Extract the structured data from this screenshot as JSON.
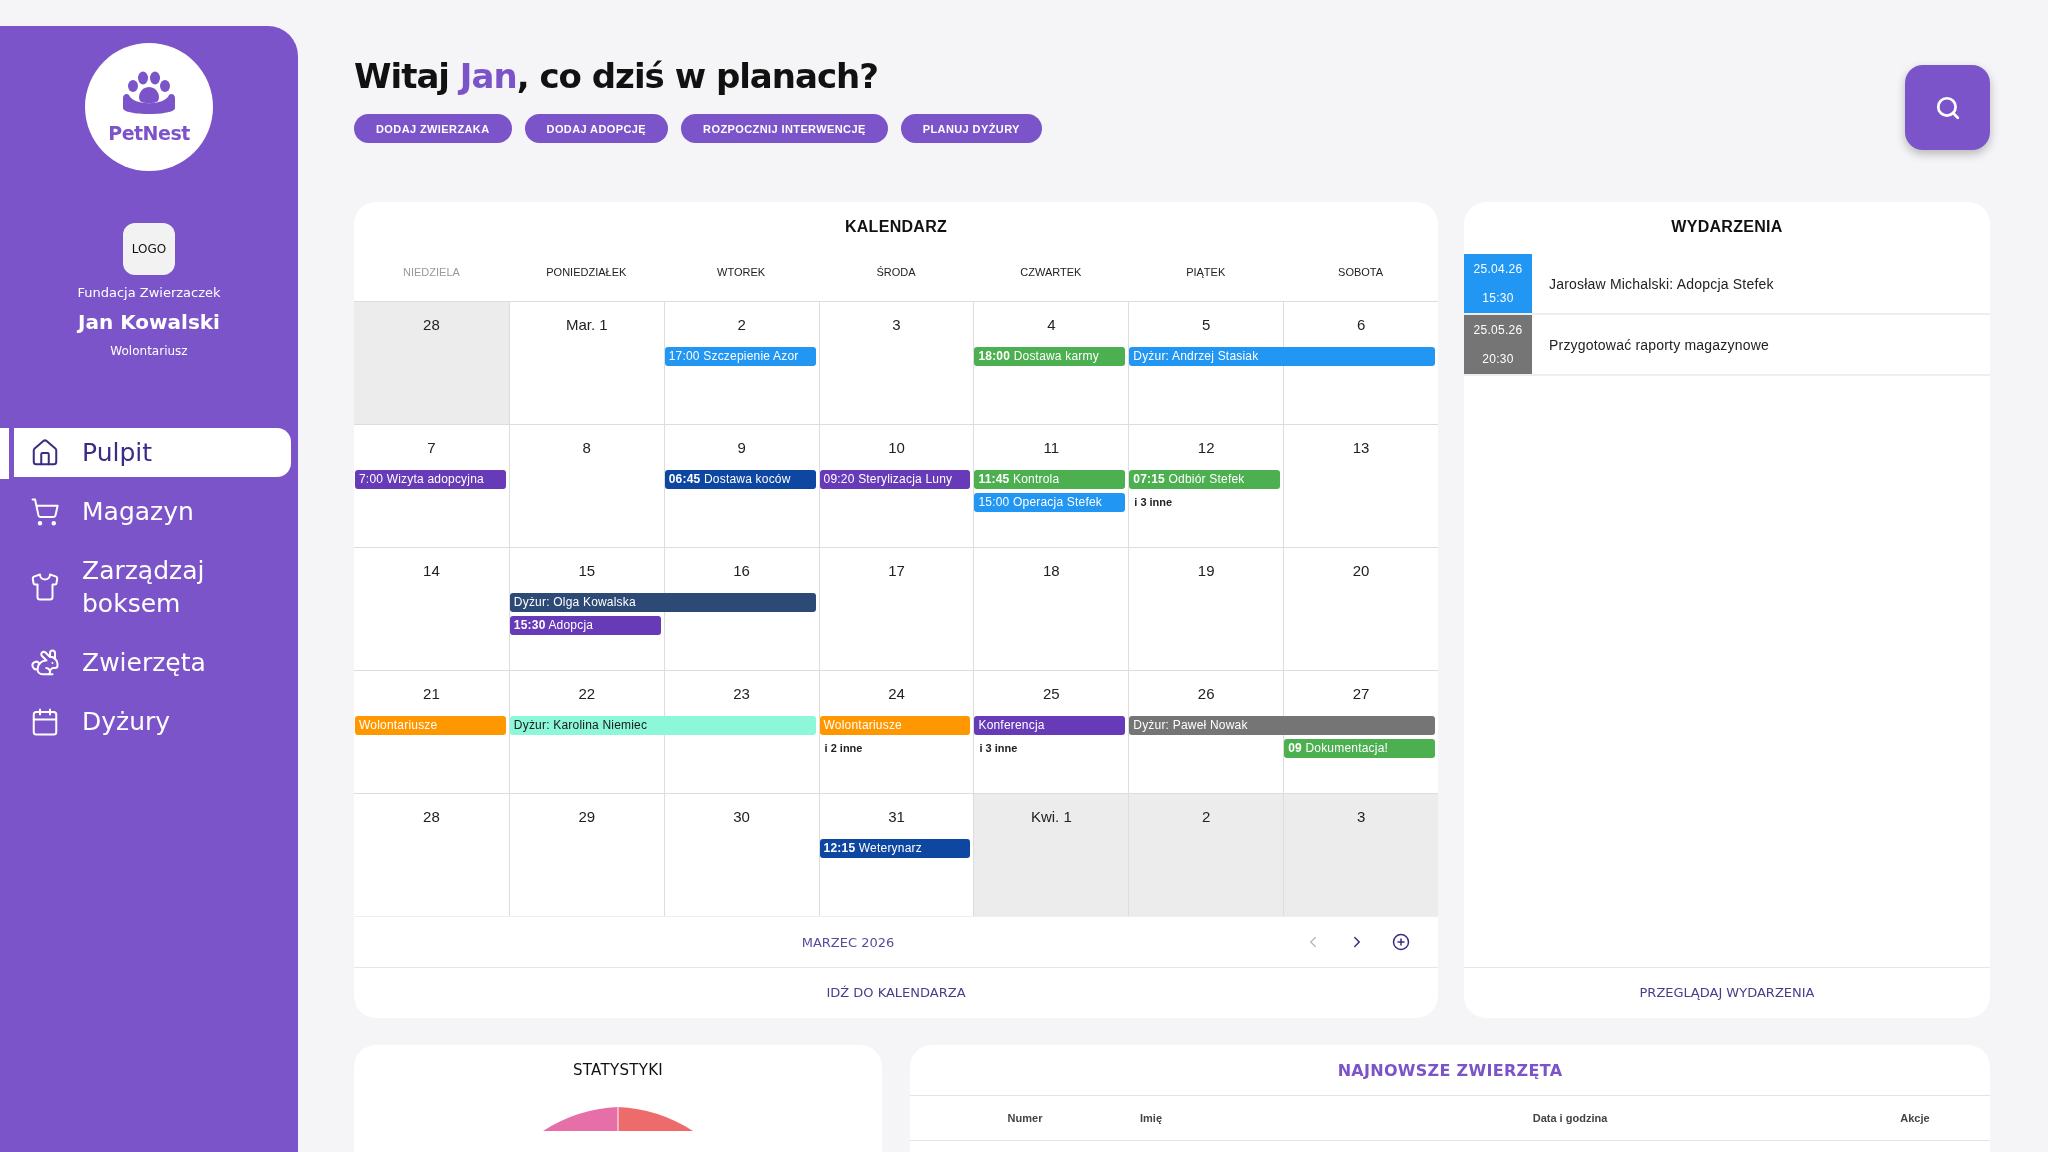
{
  "sidebar": {
    "brand": "PetNest",
    "org_logo": "LOGO",
    "organization": "Fundacja Zwierzaczek",
    "user_name": "Jan Kowalski",
    "user_role": "Wolontariusz",
    "items": [
      {
        "label": "Pulpit",
        "selected": true
      },
      {
        "label": "Magazyn",
        "selected": false
      },
      {
        "label": "Zarządzaj boksem",
        "selected": false
      },
      {
        "label": "Zwierzęta",
        "selected": false
      },
      {
        "label": "Dyżury",
        "selected": false
      }
    ]
  },
  "header": {
    "greeting": "Witaj",
    "name": "Jan",
    "question": ", co dziś w planach?",
    "actions": [
      "DODAJ ZWIERZAKA",
      "DODAJ ADOPCJĘ",
      "ROZPOCZNIJ INTERWENCJĘ",
      "PLANUJ DYŻURY"
    ]
  },
  "calendar": {
    "title": "KALENDARZ",
    "weekdays": [
      {
        "label": "NIEDZIELA",
        "dimmed": true
      },
      {
        "label": "PONIEDZIAŁEK",
        "dimmed": false
      },
      {
        "label": "WTOREK",
        "dimmed": false
      },
      {
        "label": "ŚRODA",
        "dimmed": false
      },
      {
        "label": "CZWARTEK",
        "dimmed": false
      },
      {
        "label": "PIĄTEK",
        "dimmed": false
      },
      {
        "label": "SOBOTA",
        "dimmed": false
      }
    ],
    "weeks": [
      {
        "days": [
          {
            "label": "28",
            "muted": true
          },
          {
            "label": "Mar. 1",
            "muted": false
          },
          {
            "label": "2",
            "muted": false,
            "events": [
              {
                "kind": "event",
                "text": "17:00 Szczepienie Azor",
                "color": "#2196f3"
              }
            ]
          },
          {
            "label": "3",
            "muted": false
          },
          {
            "label": "4",
            "muted": false,
            "events": [
              {
                "kind": "event",
                "text": "**18:00** Dostawa karmy",
                "color": "#4caf50"
              }
            ]
          },
          {
            "label": "5",
            "muted": false,
            "events": [
              {
                "kind": "event",
                "text": "Dyżur: Andrzej Stasiak",
                "color": "#2196f3",
                "continues_next_day": true
              }
            ]
          },
          {
            "label": "6",
            "muted": false
          }
        ]
      },
      {
        "days": [
          {
            "label": "7",
            "muted": false,
            "events": [
              {
                "kind": "event",
                "text": "7:00 Wizyta adopcyjna",
                "color": "#673ab7"
              }
            ]
          },
          {
            "label": "8",
            "muted": false
          },
          {
            "label": "9",
            "muted": false,
            "events": [
              {
                "kind": "event",
                "text": "**06:45** Dostawa koców",
                "color": "#0d47a1"
              }
            ]
          },
          {
            "label": "10",
            "muted": false,
            "events": [
              {
                "kind": "event",
                "text": "09:20 Sterylizacja Luny",
                "color": "#673ab7"
              }
            ]
          },
          {
            "label": "11",
            "muted": false,
            "events": [
              {
                "kind": "event",
                "text": "**11:45** Kontrola",
                "color": "#4caf50"
              },
              {
                "kind": "event",
                "text": "15:00 Operacja Stefek",
                "color": "#2196f3"
              }
            ]
          },
          {
            "label": "12",
            "muted": false,
            "events": [
              {
                "kind": "event",
                "text": "**07:15** Odbiór Stefek",
                "color": "#4caf50"
              },
              {
                "kind": "more",
                "text": "i 3 inne"
              }
            ]
          },
          {
            "label": "13",
            "muted": false
          }
        ]
      },
      {
        "days": [
          {
            "label": "14",
            "muted": false
          },
          {
            "label": "15",
            "muted": false,
            "events": [
              {
                "kind": "event",
                "text": "Dyżur: Olga Kowalska",
                "color": "#2c4a75",
                "continues_next_day": true
              },
              {
                "kind": "event",
                "text": "**15:30** Adopcja",
                "color": "#673ab7"
              }
            ]
          },
          {
            "label": "16",
            "muted": false
          },
          {
            "label": "17",
            "muted": false
          },
          {
            "label": "18",
            "muted": false
          },
          {
            "label": "19",
            "muted": false
          },
          {
            "label": "20",
            "muted": false
          }
        ]
      },
      {
        "days": [
          {
            "label": "21",
            "muted": false,
            "events": [
              {
                "kind": "event",
                "text": "Wolontariusze",
                "color": "#ff9800"
              }
            ]
          },
          {
            "label": "22",
            "muted": false,
            "events": [
              {
                "kind": "event",
                "text": "Dyżur: Karolina Niemiec",
                "color": "#8df7d9",
                "continues_next_day": true
              }
            ]
          },
          {
            "label": "23",
            "muted": false
          },
          {
            "label": "24",
            "muted": false,
            "events": [
              {
                "kind": "event",
                "text": "Wolontariusze",
                "color": "#ff9800"
              },
              {
                "kind": "more",
                "text": "i 2 inne"
              }
            ]
          },
          {
            "label": "25",
            "muted": false,
            "events": [
              {
                "kind": "event",
                "text": "Konferencja",
                "color": "#673ab7"
              },
              {
                "kind": "more",
                "text": "i 3 inne"
              }
            ]
          },
          {
            "label": "26",
            "muted": false,
            "events": [
              {
                "kind": "event",
                "text": "Dyżur: Paweł Nowak",
                "color": "#757575",
                "continues_next_day": true
              }
            ]
          },
          {
            "label": "27",
            "muted": false,
            "events": [
              {
                "kind": "event",
                "text": "**09** Dokumentacja!",
                "color": "#4caf50"
              }
            ]
          }
        ]
      },
      {
        "days": [
          {
            "label": "28",
            "muted": false
          },
          {
            "label": "29",
            "muted": false
          },
          {
            "label": "30",
            "muted": false
          },
          {
            "label": "31",
            "muted": false,
            "events": [
              {
                "kind": "event",
                "text": "**12:15** Weterynarz",
                "color": "#0d47a1"
              }
            ]
          },
          {
            "label": "Kwi. 1",
            "muted": true
          },
          {
            "label": "2",
            "muted": true
          },
          {
            "label": "3",
            "muted": true
          }
        ]
      }
    ],
    "month": "MARZEC 2026",
    "prev_disabled": true,
    "link": "IDŹ DO KALENDARZA"
  },
  "events_panel": {
    "title": "WYDARZENIA",
    "items": [
      {
        "date": "25.04.26",
        "time": "15:30",
        "text": "Jarosław Michalski: Adopcja Stefek",
        "color": "#2196f3"
      },
      {
        "date": "25.05.26",
        "time": "20:30",
        "text": "Przygotować raporty magazynowe",
        "color": "#757575"
      }
    ],
    "link": "PRZEGLĄDAJ WYDARZENIA"
  },
  "stats": {
    "title": "STATYSTYKI"
  },
  "newest_animals": {
    "title": "NAJNOWSZE ZWIERZĘTA",
    "columns": [
      "Numer",
      "Imię",
      "Data i godzina",
      "Akcje"
    ]
  }
}
